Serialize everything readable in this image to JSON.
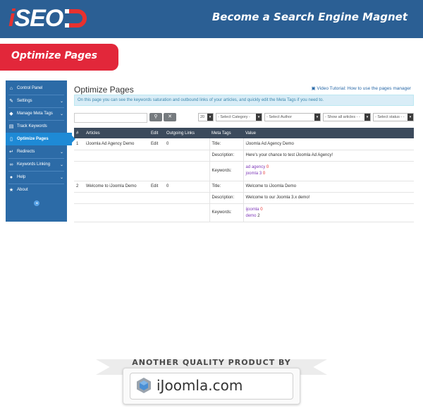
{
  "header": {
    "logo_i": "i",
    "logo_seo": "SEO",
    "tagline": "Become a Search Engine Magnet"
  },
  "ribbon": {
    "label": "Optimize Pages"
  },
  "sidebar": {
    "items": [
      {
        "label": "Control Panel",
        "icon": "home-icon",
        "has_chevron": false
      },
      {
        "label": "Settings",
        "icon": "wrench-icon",
        "has_chevron": true
      },
      {
        "label": "Manage Meta Tags",
        "icon": "tags-icon",
        "has_chevron": true
      },
      {
        "label": "Track Keywords",
        "icon": "document-icon",
        "has_chevron": false
      },
      {
        "label": "Optimize Pages",
        "icon": "page-icon",
        "has_chevron": false,
        "active": true
      },
      {
        "label": "Redirects",
        "icon": "redirect-icon",
        "has_chevron": true
      },
      {
        "label": "Keywords Linking",
        "icon": "link-icon",
        "has_chevron": true
      },
      {
        "label": "Help",
        "icon": "help-icon",
        "has_chevron": true
      },
      {
        "label": "About",
        "icon": "star-icon",
        "has_chevron": false
      }
    ]
  },
  "main": {
    "title": "Optimize Pages",
    "video_link": "Video Tutorial: How to use the pages manager",
    "info": "On this page you can see the keywords saturation and outbound links of your articles, and quickly edit the Meta Tags if you need to.",
    "search": {
      "value": "",
      "placeholder": ""
    },
    "filters": {
      "limit": "20",
      "category": "- Select Category -",
      "author": "- Select Author",
      "articles": "- Show all articles - -",
      "status": "- Select status - -"
    },
    "table": {
      "headers": [
        "#",
        "Articles",
        "Edit",
        "Outgoing Links",
        "Meta Tags",
        "Value"
      ],
      "rows": [
        {
          "num": "1",
          "article": "iJoomla Ad Agency Demo",
          "edit": "Edit",
          "links": "0",
          "title_label": "Title:",
          "title_value": "iJoomla Ad Agency Demo",
          "desc_label": "Description:",
          "desc_value": "Here's your chance to test iJoomla Ad Agency!",
          "kw_label": "Keywords:",
          "keywords": [
            {
              "word": "ad agency",
              "count": "0"
            },
            {
              "word": "joomla 3",
              "count": "0"
            }
          ]
        },
        {
          "num": "2",
          "article": "Welcome to iJoomla Demo",
          "edit": "Edit",
          "links": "0",
          "title_label": "Title:",
          "title_value": "Welcome to iJoomla Demo",
          "desc_label": "Description:",
          "desc_value": "Welcome to our Joomla 3.x demo!",
          "kw_label": "Keywords:",
          "keywords": [
            {
              "word": "ijoomla",
              "count": "0"
            },
            {
              "word": "demo",
              "count": "2"
            }
          ]
        }
      ]
    }
  },
  "footer": {
    "top_text": "ANOTHER QUALITY PRODUCT BY",
    "brand": "iJoomla.com"
  },
  "colors": {
    "header_bg": "#2b5f94",
    "accent_red": "#e2273a",
    "sidebar_bg": "#2c6ba7",
    "sidebar_active": "#1e8ad6",
    "table_header": "#3b4a5c"
  }
}
